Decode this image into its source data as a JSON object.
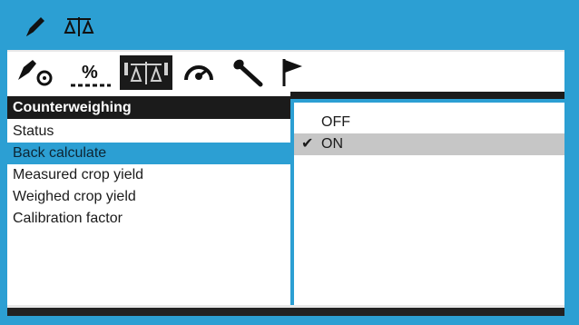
{
  "header": {
    "icons": [
      "pencil-icon",
      "scale-icon"
    ]
  },
  "toolbar": {
    "tabs": [
      {
        "icon": "sensor-icon",
        "text": ""
      },
      {
        "icon": "percent-icon",
        "text": "%"
      },
      {
        "icon": "counterweigh-scale-icon",
        "text": ""
      },
      {
        "icon": "gauge-icon",
        "text": ""
      },
      {
        "icon": "wrench-icon",
        "text": ""
      },
      {
        "icon": "flag-icon",
        "text": ""
      }
    ]
  },
  "menu": {
    "title": "Counterweighing",
    "items": [
      {
        "label": "Status"
      },
      {
        "label": "Back calculate"
      },
      {
        "label": "Measured crop yield"
      },
      {
        "label": "Weighed crop yield"
      },
      {
        "label": "Calibration factor"
      }
    ],
    "selected_index": 1
  },
  "options": {
    "items": [
      {
        "label": "OFF"
      },
      {
        "label": "ON"
      }
    ],
    "selected_index": 1,
    "check_glyph": "✔"
  },
  "colors": {
    "accent": "#2c9fd3",
    "dark": "#1b1b1b",
    "highlight": "#c6c6c6"
  }
}
